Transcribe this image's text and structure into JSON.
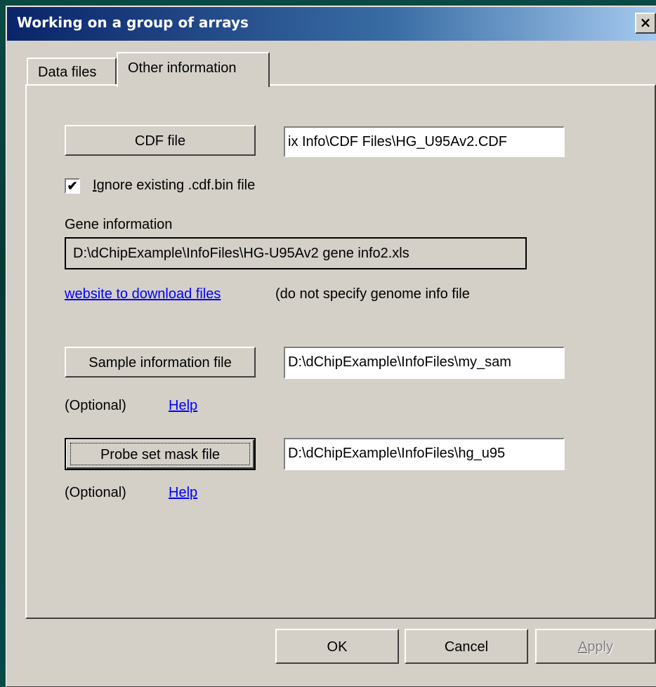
{
  "window": {
    "title": "Working on a group of arrays",
    "close_label": "×"
  },
  "tabs": [
    {
      "label": "Data files",
      "active": false
    },
    {
      "label": "Other information",
      "active": true
    }
  ],
  "cdf": {
    "button_label": "CDF file",
    "path_value": "ix Info\\CDF Files\\HG_U95Av2.CDF",
    "ignore_checkbox": {
      "checked": true,
      "mark": "✔",
      "label_first": "I",
      "label_rest": "gnore existing .cdf.bin file"
    }
  },
  "gene": {
    "heading": "Gene information",
    "path_value": "D:\\dChipExample\\InfoFiles\\HG-U95Av2 gene info2.xls",
    "download_link": "website to download files",
    "note": "(do not specify genome info file"
  },
  "sample": {
    "button_label": "Sample information file",
    "path_value": "D:\\dChipExample\\InfoFiles\\my_sam",
    "optional_label": "(Optional)",
    "help_link": "Help"
  },
  "mask": {
    "button_label": "Probe set mask file",
    "path_value": "D:\\dChipExample\\InfoFiles\\hg_u95",
    "optional_label": "(Optional)",
    "help_link": "Help"
  },
  "footer": {
    "ok_label": "OK",
    "cancel_label": "Cancel",
    "apply_first": "A",
    "apply_rest": "pply"
  },
  "colors": {
    "dialog_bg": "#d4d0c8",
    "titlebar_start": "#0a246a",
    "titlebar_end": "#a6caf0",
    "link": "#0000ff",
    "desktop": "#063a36"
  }
}
